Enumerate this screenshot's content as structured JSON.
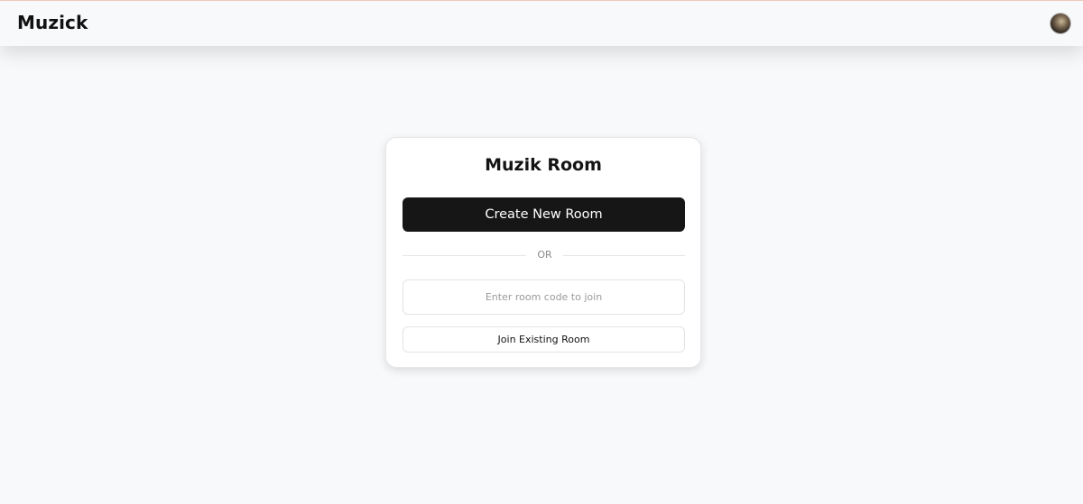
{
  "header": {
    "brand": "Muzick",
    "avatar_icon": "user-avatar"
  },
  "card": {
    "title": "Muzik Room",
    "create_button_label": "Create New Room",
    "divider_label": "OR",
    "room_code_input": {
      "placeholder": "Enter room code to join",
      "value": ""
    },
    "join_button_label": "Join Existing Room"
  },
  "colors": {
    "page_background": "#f8f9fb",
    "primary_button": "#161616",
    "primary_button_text": "#ffffff",
    "border": "#e3e3e6"
  }
}
